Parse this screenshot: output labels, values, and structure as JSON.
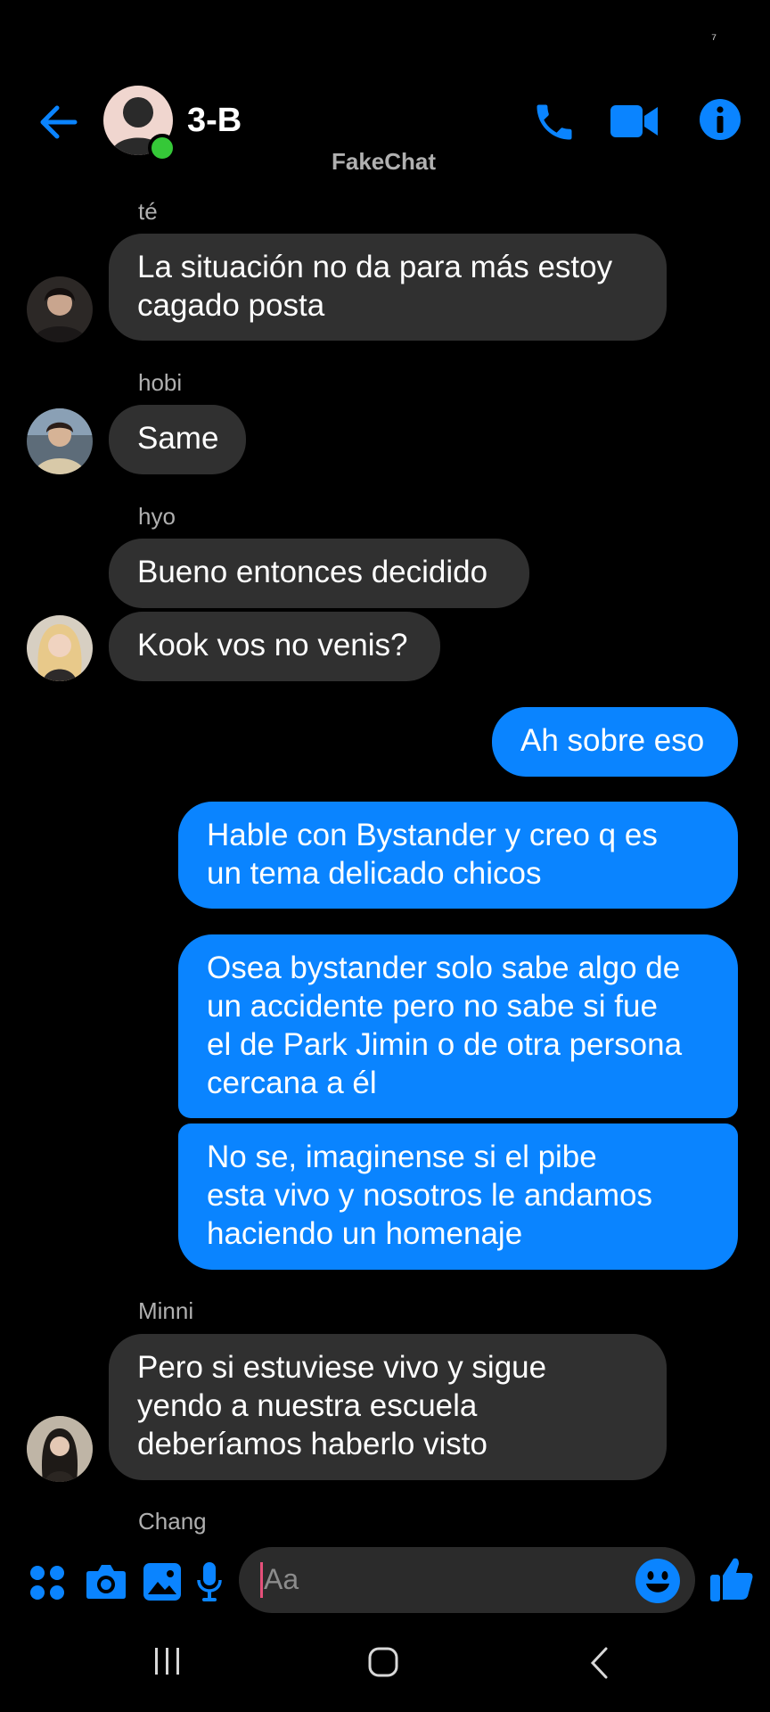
{
  "status_bar": {
    "indicator": "⁷"
  },
  "header": {
    "title": "3-B",
    "subtitle": "FakeChat",
    "icons": [
      "back-arrow-icon",
      "phone-icon",
      "video-camera-icon",
      "info-icon"
    ],
    "accent_color": "#0a84ff"
  },
  "messages": [
    {
      "sender": "té",
      "text": "La situación no da para más estoy\ncagado posta",
      "direction": "incoming"
    },
    {
      "sender": "hobi",
      "text": "Same",
      "direction": "incoming"
    },
    {
      "sender": "hyo",
      "text": "Bueno entonces decidido",
      "direction": "incoming"
    },
    {
      "sender": "hyo",
      "text": "Kook vos no venis?",
      "direction": "incoming"
    },
    {
      "sender": "me",
      "text": "Ah sobre eso",
      "direction": "outgoing"
    },
    {
      "sender": "me",
      "text": "Hable con Bystander y creo q es\nun tema delicado chicos",
      "direction": "outgoing"
    },
    {
      "sender": "me",
      "text": "Osea bystander solo sabe algo de\nun accidente pero no sabe si fue\nel de Park Jimin o de otra persona\ncercana a él",
      "direction": "outgoing"
    },
    {
      "sender": "me",
      "text": "No se, imaginense si el pibe\nesta vivo y nosotros le andamos\nhaciendo un homenaje",
      "direction": "outgoing"
    },
    {
      "sender": "Minni",
      "text": "Pero si estuviese vivo y sigue\nyendo a nuestra escuela\ndeberíamos haberlo visto",
      "direction": "incoming"
    }
  ],
  "typing_sender": "Chang",
  "composer": {
    "placeholder": "Aa",
    "icons": [
      "apps-grid-icon",
      "camera-icon",
      "gallery-icon",
      "microphone-icon",
      "emoji-icon",
      "like-thumb-icon"
    ]
  },
  "nav_bar": {
    "icons": [
      "recent-apps-icon",
      "home-icon",
      "back-icon"
    ]
  }
}
